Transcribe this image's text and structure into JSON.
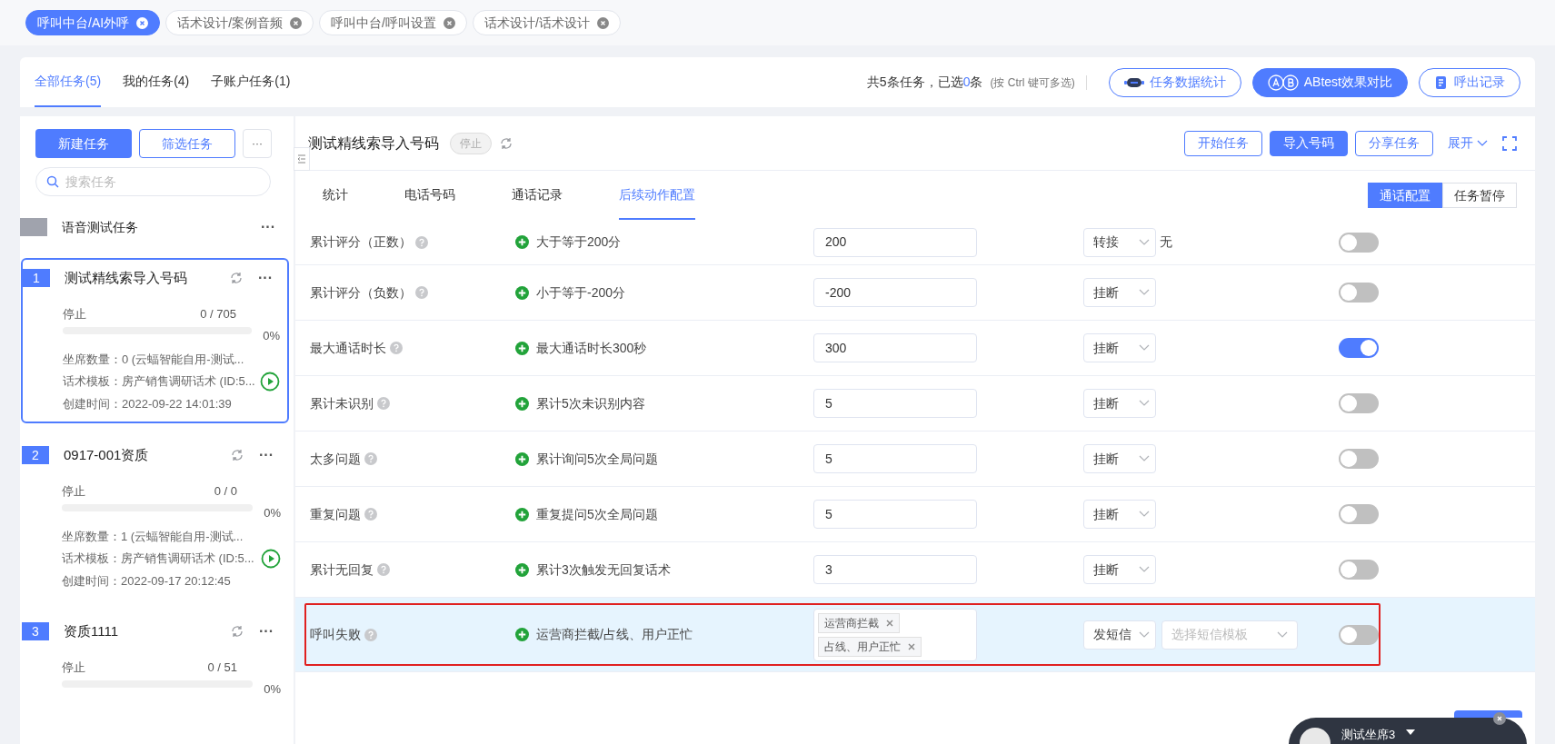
{
  "top_tabs": [
    {
      "label": "呼叫中台/AI外呼",
      "selected": true
    },
    {
      "label": "话术设计/案例音频",
      "selected": false
    },
    {
      "label": "呼叫中台/呼叫设置",
      "selected": false
    },
    {
      "label": "话术设计/话术设计",
      "selected": false
    }
  ],
  "main_tabs": [
    {
      "label": "全部任务(5)",
      "selected": true
    },
    {
      "label": "我的任务(4)",
      "selected": false
    },
    {
      "label": "子账户任务(1)",
      "selected": false
    }
  ],
  "summary": {
    "prefix": "共5条任务，已选",
    "count": "0",
    "suffix": "条",
    "hint": "(按 Ctrl 键可多选)"
  },
  "header_buttons": [
    {
      "label": "任务数据统计",
      "kind": "stats",
      "primary": false
    },
    {
      "label": "ABtest效果对比",
      "kind": "ab",
      "primary": true
    },
    {
      "label": "呼出记录",
      "kind": "record",
      "primary": false
    }
  ],
  "sidebar": {
    "new_task": "新建任务",
    "filter": "筛选任务",
    "more": "···",
    "search_placeholder": "搜索任务",
    "group": {
      "name": "语音测试任务",
      "more": "···"
    },
    "tasks": [
      {
        "index": "1",
        "name": "测试精线索导入号码",
        "selected": true,
        "more": "···",
        "status": "停止",
        "count": "0 / 705",
        "level": 0,
        "percent": "0%",
        "seats": "坐席数量：0 (云蝠智能自用-测试...",
        "template": "话术模板：房产销售调研话术 (ID:5...",
        "created": "创建时间：2022-09-22 14:01:39"
      },
      {
        "index": "2",
        "name": "0917-001资质",
        "selected": false,
        "more": "···",
        "status": "停止",
        "count": "0 / 0",
        "level": 0,
        "percent": "0%",
        "seats": "坐席数量：1 (云蝠智能自用-测试...",
        "template": "话术模板：房产销售调研话术 (ID:5...",
        "created": "创建时间：2022-09-17 20:12:45"
      },
      {
        "index": "3",
        "name": "资质1111",
        "selected": false,
        "more": "···",
        "status": "停止",
        "count": "0 / 51",
        "level": 0,
        "percent": "0%"
      }
    ]
  },
  "detail": {
    "title": "测试精线索导入号码",
    "status": "停止",
    "actions": [
      {
        "label": "开始任务",
        "primary": false
      },
      {
        "label": "导入号码",
        "primary": true
      },
      {
        "label": "分享任务",
        "primary": false
      }
    ],
    "expand": "展开",
    "subtabs": [
      {
        "label": "统计",
        "selected": false
      },
      {
        "label": "电话号码",
        "selected": false
      },
      {
        "label": "通话记录",
        "selected": false
      },
      {
        "label": "后续动作配置",
        "selected": true
      }
    ],
    "modes": [
      {
        "label": "通话配置",
        "selected": true
      },
      {
        "label": "任务暂停",
        "selected": false
      }
    ],
    "rules": [
      {
        "kind": "input",
        "label": "累计评分（正数）",
        "condition": "大于等于200分",
        "value": "200",
        "action": "转接",
        "extra": "无",
        "on": false,
        "highlighted": false
      },
      {
        "kind": "input",
        "label": "累计评分（负数）",
        "condition": "小于等于-200分",
        "value": "-200",
        "action": "挂断",
        "on": false,
        "highlighted": false
      },
      {
        "kind": "input",
        "label": "最大通话时长",
        "condition": "最大通话时长300秒",
        "value": "300",
        "action": "挂断",
        "on": true,
        "highlighted": false
      },
      {
        "kind": "input",
        "label": "累计未识别",
        "condition": "累计5次未识别内容",
        "value": "5",
        "action": "挂断",
        "on": false,
        "highlighted": false
      },
      {
        "kind": "input",
        "label": "太多问题",
        "condition": "累计询问5次全局问题",
        "value": "5",
        "action": "挂断",
        "on": false,
        "highlighted": false
      },
      {
        "kind": "input",
        "label": "重复问题",
        "condition": "重复提问5次全局问题",
        "value": "5",
        "action": "挂断",
        "on": false,
        "highlighted": false
      },
      {
        "kind": "input",
        "label": "累计无回复",
        "condition": "累计3次触发无回复话术",
        "value": "3",
        "action": "挂断",
        "on": false,
        "highlighted": false
      },
      {
        "kind": "tags",
        "label": "呼叫失败",
        "condition": "运营商拦截/占线、用户正忙",
        "tags": [
          "运营商拦截",
          "占线、用户正忙"
        ],
        "action": "发短信",
        "template_placeholder": "选择短信模板",
        "on": false,
        "highlighted": true
      }
    ]
  },
  "agent_widget": {
    "name": "测试坐席3"
  }
}
